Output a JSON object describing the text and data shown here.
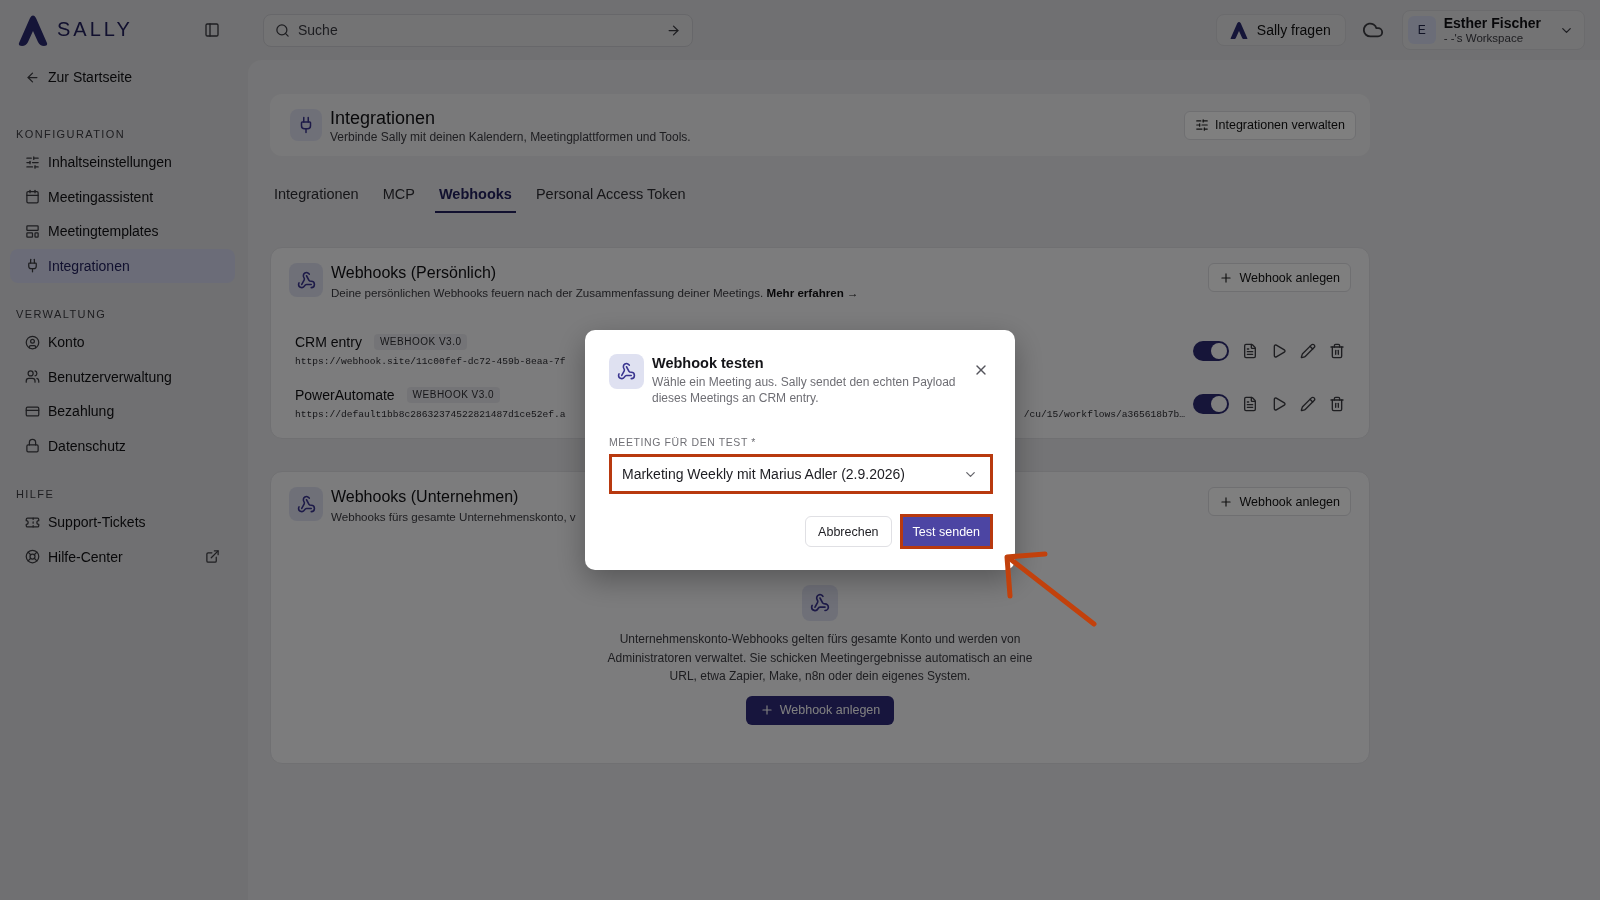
{
  "brand": {
    "name": "SALLY"
  },
  "topbar": {
    "search": {
      "placeholder": "Suche"
    },
    "ask_button": "Sally fragen",
    "user": {
      "initial": "E",
      "name": "Esther Fischer",
      "workspace": "- -'s Workspace"
    }
  },
  "sidebar": {
    "back_link": "Zur Startseite",
    "sections": [
      {
        "title": "KONFIGURATION",
        "items": [
          {
            "label": "Inhaltseinstellungen",
            "selected": false,
            "external": false
          },
          {
            "label": "Meetingassistent",
            "selected": false,
            "external": false
          },
          {
            "label": "Meetingtemplates",
            "selected": false,
            "external": false
          },
          {
            "label": "Integrationen",
            "selected": true,
            "external": false
          }
        ]
      },
      {
        "title": "VERWALTUNG",
        "items": [
          {
            "label": "Konto",
            "selected": false,
            "external": false
          },
          {
            "label": "Benutzerverwaltung",
            "selected": false,
            "external": false
          },
          {
            "label": "Bezahlung",
            "selected": false,
            "external": false
          },
          {
            "label": "Datenschutz",
            "selected": false,
            "external": false
          }
        ]
      },
      {
        "title": "HILFE",
        "items": [
          {
            "label": "Support-Tickets",
            "selected": false,
            "external": false
          },
          {
            "label": "Hilfe-Center",
            "selected": false,
            "external": true
          }
        ]
      }
    ]
  },
  "page_header": {
    "title": "Integrationen",
    "subtitle": "Verbinde Sally mit deinen Kalendern, Meetingplattformen und Tools.",
    "action": "Integrationen verwalten"
  },
  "tabs": [
    {
      "label": "Integrationen",
      "selected": false
    },
    {
      "label": "MCP",
      "selected": false
    },
    {
      "label": "Webhooks",
      "selected": true
    },
    {
      "label": "Personal Access Token",
      "selected": false
    }
  ],
  "sections": [
    {
      "title": "Webhooks (Persönlich)",
      "description": "Deine persönlichen Webhooks feuern nach der Zusammenfassung deiner Meetings.",
      "link": "Mehr erfahren →",
      "add_button": "Webhook anlegen",
      "webhooks": [
        {
          "name": "CRM entry",
          "version": "WEBHOOK V3.0",
          "url_start": "https://webhook.site/11c00fef-dc72-459b-8eaa-7f",
          "on": true
        },
        {
          "name": "PowerAutomate",
          "version": "WEBHOOK V3.0",
          "url_start": "https://default1bb8c28632374522821487d1ce52ef.a",
          "url_end": "/cu/15/workflows/a365618b7b…",
          "on": true
        }
      ]
    },
    {
      "title": "Webhooks (Unternehmen)",
      "description": "Webhooks fürs gesamte Unternehmenskonto, v",
      "add_button": "Webhook anlegen",
      "empty_state": {
        "text": "Unternehmenskonto-Webhooks gelten fürs gesamte Konto und werden von Administratoren verwaltet. Sie schicken Meetingergebnisse automatisch an eine URL, etwa Zapier, Make, n8n oder dein eigenes System.",
        "button": "Webhook anlegen"
      }
    }
  ],
  "modal": {
    "title": "Webhook testen",
    "description": "Wähle ein Meeting aus. Sally sendet den echten Payload dieses Meetings an CRM entry.",
    "field_label": "MEETING FÜR DEN TEST *",
    "select": {
      "value": "Marketing Weekly mit Marius Adler (2.9.2026)",
      "highlighted": true
    },
    "buttons": [
      {
        "label": "Abbrechen",
        "kind": "secondary",
        "highlighted": false
      },
      {
        "label": "Test senden",
        "kind": "primary",
        "highlighted": true
      }
    ]
  },
  "annotations": [
    {
      "kind": "arrow"
    }
  ]
}
